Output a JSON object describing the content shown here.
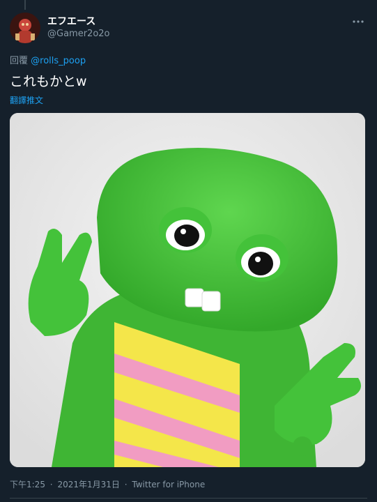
{
  "tweet": {
    "display_name": "エフエース",
    "handle": "@Gamer2o2o",
    "reply_prefix": "回覆",
    "reply_mention": "@rolls_poop",
    "text": "これもかとw",
    "translate_label": "翻譯推文",
    "time": "下午1:25",
    "date": "2021年1月31日",
    "source": "Twitter for iPhone",
    "separator": "·"
  },
  "icons": {
    "more": "more-horizontal-icon"
  },
  "colors": {
    "background": "#15202b",
    "link": "#1da1f2",
    "secondary_text": "#8899a6",
    "character_green": "#45c43a",
    "belly_yellow": "#f4e64a",
    "belly_pink": "#f19cc2"
  }
}
